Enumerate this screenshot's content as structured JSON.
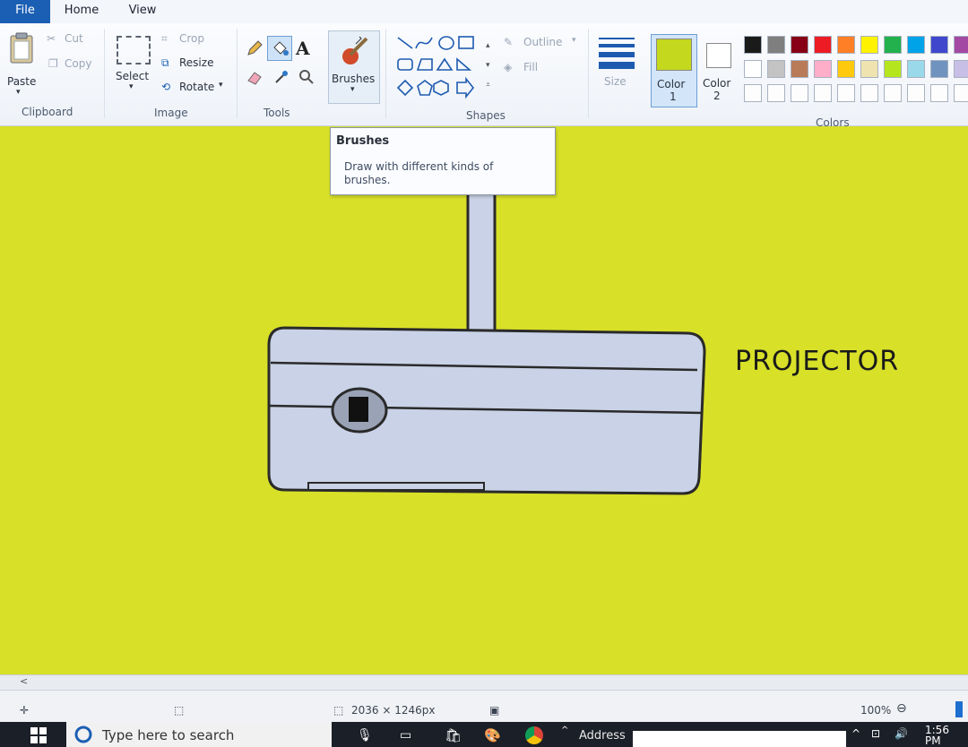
{
  "tabs": {
    "file": "File",
    "home": "Home",
    "view": "View"
  },
  "clipboard": {
    "paste": "Paste",
    "cut": "Cut",
    "copy": "Copy",
    "group": "Clipboard"
  },
  "image": {
    "select": "Select",
    "crop": "Crop",
    "resize": "Resize",
    "rotate": "Rotate",
    "group": "Image"
  },
  "tools": {
    "group": "Tools",
    "brushes": "Brushes",
    "text_glyph": "A"
  },
  "shapes": {
    "outline": "Outline",
    "fill": "Fill",
    "group": "Shapes"
  },
  "size": {
    "label": "Size"
  },
  "colors": {
    "color1": "Color",
    "color1_num": "1",
    "color2": "Color",
    "color2_num": "2",
    "group": "Colors",
    "color1_value": "#c4d81e",
    "color2_value": "#ffffff",
    "palette_row1": [
      "#1a1a1a",
      "#7f7f7f",
      "#880015",
      "#ed1c24",
      "#ff7f27",
      "#fff200",
      "#22b14c",
      "#00a2e8",
      "#3f48cc",
      "#a349a4"
    ],
    "palette_row2": [
      "#ffffff",
      "#c3c3c3",
      "#b97a57",
      "#ffaec9",
      "#ffc90e",
      "#efe4b0",
      "#b5e61d",
      "#99d9ea",
      "#7092be",
      "#c8bfe7"
    ]
  },
  "tooltip": {
    "title": "Brushes",
    "description": "Draw with different kinds of brushes."
  },
  "canvas": {
    "background": "#d8e028",
    "label": "PROJECTOR"
  },
  "status": {
    "dimensions": "2036 × 1246px",
    "zoom": "100%"
  },
  "taskbar": {
    "search_placeholder": "Type here to search",
    "address_label": "Address",
    "time": "1:56 PM"
  }
}
